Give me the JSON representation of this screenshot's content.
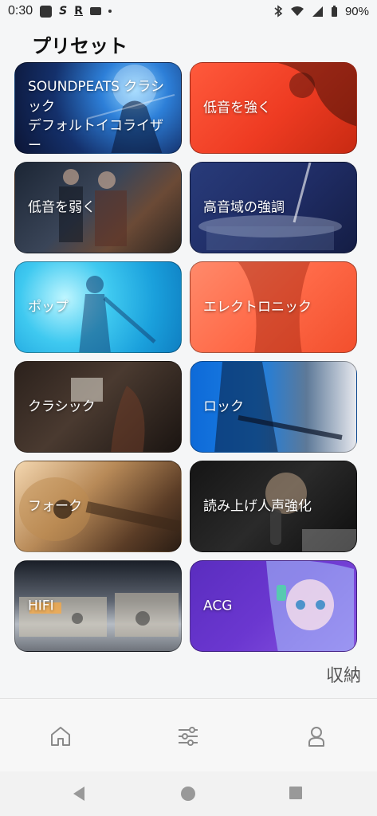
{
  "status_bar": {
    "time": "0:30",
    "icons_left": [
      "photo-notification-icon",
      "s-app-icon",
      "r-app-icon",
      "card-icon",
      "more-dot-icon"
    ],
    "icons_right": [
      "bluetooth-icon",
      "wifi-icon",
      "signal-icon",
      "battery-icon"
    ],
    "battery": "90%"
  },
  "page": {
    "title": "プリセット"
  },
  "presets": [
    {
      "label": "SOUNDPEATS クラシック\nデフォルトイコライザー",
      "image": "violinist-stage-light"
    },
    {
      "label": "低音を強く",
      "image": "singer-red-silhouette"
    },
    {
      "label": "低音を弱く",
      "image": "musicians-studio"
    },
    {
      "label": "高音域の強調",
      "image": "drummer-hands"
    },
    {
      "label": "ポップ",
      "image": "pop-performer-blue"
    },
    {
      "label": "エレクトロニック",
      "image": "electric-guitarist-orange"
    },
    {
      "label": "クラシック",
      "image": "orchestra-strings"
    },
    {
      "label": "ロック",
      "image": "rock-guitarist-smoke"
    },
    {
      "label": "フォーク",
      "image": "acoustic-guitar"
    },
    {
      "label": "読み上げ人声強化",
      "image": "singer-microphone"
    },
    {
      "label": "HIFI",
      "image": "hifi-amplifier"
    },
    {
      "label": "ACG",
      "image": "anime-character"
    }
  ],
  "collapse_label": "収納",
  "bottom_nav": {
    "items": [
      {
        "icon": "home-icon"
      },
      {
        "icon": "equalizer-icon"
      },
      {
        "icon": "user-icon"
      }
    ]
  },
  "system_nav": [
    "back-icon",
    "home-circle-icon",
    "recents-icon"
  ],
  "colors": {
    "background": "#f5f6f7",
    "card_text": "#ffffff",
    "icon_gray": "#8a8a8a"
  }
}
